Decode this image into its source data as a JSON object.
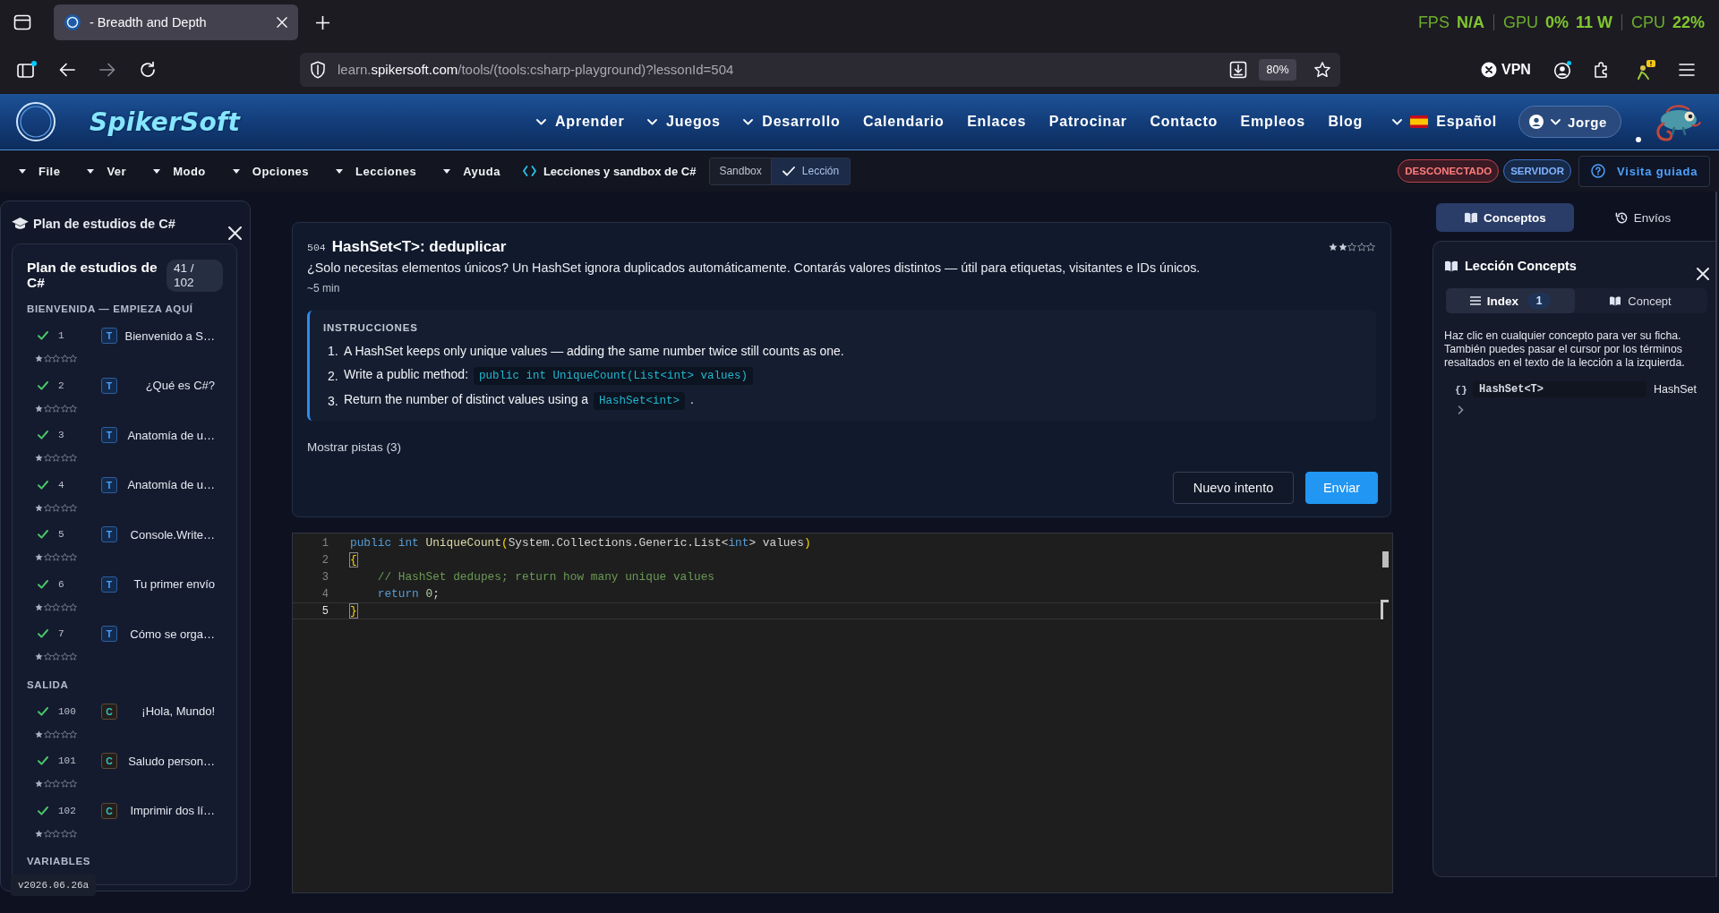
{
  "browser": {
    "tab": {
      "title": "- Breadth and Depth"
    },
    "address": {
      "prefix": "learn.",
      "domain": "spikersoft.com",
      "path": "/tools/(tools:csharp-playground)?lessonId=504"
    },
    "zoom": "80%",
    "vpn": "VPN"
  },
  "overlay": [
    {
      "label": "FPS",
      "values": [
        "N/A"
      ]
    },
    {
      "label": "GPU",
      "values": [
        "0%",
        "11 W"
      ]
    },
    {
      "label": "CPU",
      "values": [
        "22%"
      ]
    }
  ],
  "site": {
    "logo": "SpikerSoft",
    "nav": [
      {
        "label": "Aprender",
        "dropdown": true
      },
      {
        "label": "Juegos",
        "dropdown": true
      },
      {
        "label": "Desarrollo",
        "dropdown": true
      },
      {
        "label": "Calendario",
        "dropdown": false
      },
      {
        "label": "Enlaces",
        "dropdown": false
      },
      {
        "label": "Patrocinar",
        "dropdown": false
      },
      {
        "label": "Contacto",
        "dropdown": false
      },
      {
        "label": "Empleos",
        "dropdown": false
      },
      {
        "label": "Blog",
        "dropdown": false
      }
    ],
    "language": "Español",
    "user": "Jorge"
  },
  "toolbar": {
    "menus": [
      "File",
      "Ver",
      "Modo",
      "Opciones",
      "Lecciones",
      "Ayuda"
    ],
    "context": "Lecciones y sandbox de C#",
    "modes": [
      {
        "label": "Sandbox",
        "selected": false
      },
      {
        "label": "Lección",
        "selected": true
      }
    ],
    "statuses": [
      {
        "label": "DESCONECTADO",
        "kind": "error"
      },
      {
        "label": "SERVIDOR",
        "kind": "info"
      }
    ],
    "tour": "Visita guiada"
  },
  "sidebar": {
    "title": "Plan de estudios de C#",
    "plan_title": "Plan de estudios de C#",
    "progress": "41 / 102",
    "sections": [
      {
        "title": "BIENVENIDA — EMPIEZA AQUÍ",
        "lessons": [
          {
            "number": "1",
            "kind": "theory",
            "badge": "T",
            "title": "Bienvenido a S…",
            "done": true,
            "stars": 1
          },
          {
            "number": "2",
            "kind": "theory",
            "badge": "T",
            "title": "¿Qué es C#?",
            "done": true,
            "stars": 1
          },
          {
            "number": "3",
            "kind": "theory",
            "badge": "T",
            "title": "Anatomía de u…",
            "done": true,
            "stars": 1
          },
          {
            "number": "4",
            "kind": "theory",
            "badge": "T",
            "title": "Anatomía de u…",
            "done": true,
            "stars": 1
          },
          {
            "number": "5",
            "kind": "theory",
            "badge": "T",
            "title": "Console.Write…",
            "done": true,
            "stars": 1
          },
          {
            "number": "6",
            "kind": "theory",
            "badge": "T",
            "title": "Tu primer envío",
            "done": true,
            "stars": 1
          },
          {
            "number": "7",
            "kind": "theory",
            "badge": "T",
            "title": "Cómo se orga…",
            "done": true,
            "stars": 1
          }
        ]
      },
      {
        "title": "SALIDA",
        "lessons": [
          {
            "number": "100",
            "kind": "code",
            "badge": "C",
            "title": "¡Hola, Mundo!",
            "done": true,
            "stars": 1
          },
          {
            "number": "101",
            "kind": "code",
            "badge": "C",
            "title": "Saludo person…",
            "done": true,
            "stars": 1
          },
          {
            "number": "102",
            "kind": "code",
            "badge": "C",
            "title": "Imprimir dos lí…",
            "done": true,
            "stars": 1
          }
        ]
      },
      {
        "title": "VARIABLES"
      }
    ],
    "version": "v2026.06.26a"
  },
  "lesson": {
    "number": "504",
    "title": "HashSet<T>: deduplicar",
    "stars": 2,
    "description": "¿Solo necesitas elementos únicos? Un HashSet ignora duplicados automáticamente. Contarás valores distintos — útil para etiquetas, visitantes e IDs únicos.",
    "duration": "~5 min",
    "instructions": {
      "heading": "INSTRUCCIONES",
      "steps": [
        {
          "number": "1.",
          "parts": [
            {
              "kind": "text",
              "text": "A HashSet keeps only unique values — adding the same number twice still counts as one."
            }
          ]
        },
        {
          "number": "2.",
          "parts": [
            {
              "kind": "text",
              "text": "Write a public method: "
            },
            {
              "kind": "code",
              "text": "public int UniqueCount(List<int> values)"
            }
          ]
        },
        {
          "number": "3.",
          "parts": [
            {
              "kind": "text",
              "text": "Return the number of distinct values using a "
            },
            {
              "kind": "code",
              "text": "HashSet<int>"
            },
            {
              "kind": "text",
              "text": " ."
            }
          ]
        }
      ]
    },
    "hints": "Mostrar pistas (3)",
    "actions": [
      {
        "label": "Nuevo intento",
        "kind": "secondary"
      },
      {
        "label": "Enviar",
        "kind": "primary"
      }
    ]
  },
  "editor": {
    "lines": [
      {
        "number": "1",
        "current": false,
        "tokens": [
          {
            "kind": "keyword",
            "text": "public int "
          },
          {
            "kind": "function",
            "text": "UniqueCount"
          },
          {
            "kind": "bracket",
            "text": "("
          },
          {
            "kind": "plain",
            "text": "System.Collections.Generic.List<"
          },
          {
            "kind": "keyword",
            "text": "int"
          },
          {
            "kind": "plain",
            "text": "> values"
          },
          {
            "kind": "bracket",
            "text": ")"
          }
        ]
      },
      {
        "number": "2",
        "current": false,
        "tokens": [
          {
            "kind": "bracket_match",
            "text": "{"
          }
        ]
      },
      {
        "number": "3",
        "current": false,
        "tokens": [
          {
            "kind": "comment",
            "text": "    // HashSet dedupes; return how many unique values"
          }
        ]
      },
      {
        "number": "4",
        "current": false,
        "tokens": [
          {
            "kind": "keyword",
            "text": "    return "
          },
          {
            "kind": "number",
            "text": "0"
          },
          {
            "kind": "plain",
            "text": ";"
          }
        ]
      },
      {
        "number": "5",
        "current": true,
        "tokens": [
          {
            "kind": "bracket_match",
            "text": "}"
          }
        ]
      }
    ]
  },
  "concepts": {
    "tabs": [
      {
        "label": "Conceptos",
        "selected": true
      },
      {
        "label": "Envíos",
        "selected": false
      }
    ],
    "title": "Lección Concepts",
    "views": [
      {
        "label": "Index",
        "count": "1",
        "selected": true
      },
      {
        "label": "Concept",
        "selected": false
      }
    ],
    "help": "Haz clic en cualquier concepto para ver su ficha. También puedes pasar el cursor por los términos resaltados en el texto de la lección a la izquierda.",
    "items": [
      {
        "symbol": "{}",
        "term": "HashSet<T>",
        "name": "HashSet"
      }
    ]
  }
}
